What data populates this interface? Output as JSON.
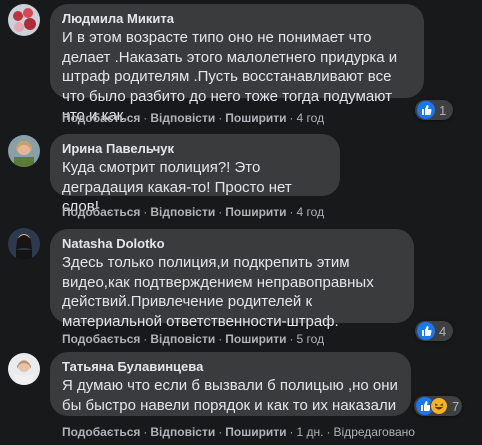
{
  "actions": {
    "like": "Подобається",
    "reply": "Відповісти",
    "share": "Поширити"
  },
  "comments": [
    {
      "author": "Людмила Микита",
      "text": "И в этом возрасте типо оно не понимает что делает .Наказать этого малолетнего придурка и штраф родителям .Пусть восстанавливают все что было разбито до него тоже тогда подумают что и как.",
      "time": "4 год",
      "reactions": {
        "types": [
          "like-icon"
        ],
        "count": "1"
      }
    },
    {
      "author": "Ирина Павельчук",
      "text": "Куда смотрит полиция?! Это деградация какая-то! Просто нет слов!",
      "time": "4 год"
    },
    {
      "author": "Natasha Dolotko",
      "text": "Здесь только полиция,и подкрепить этим видео,как подтверждением неправоправных действий.Привлечение родителей к материальной ответственности-штраф.",
      "time": "5 год",
      "reactions": {
        "types": [
          "like-icon"
        ],
        "count": "4"
      }
    },
    {
      "author": "Татьяна Булавинцева",
      "text": "Я думаю что если б вызвали б полицыю ,но они бы быстро навели порядок и как то их наказали .",
      "time": "1 дн.",
      "edited": "Відредаговано",
      "reactions": {
        "types": [
          "like-icon",
          "haha-icon"
        ],
        "count": "7"
      }
    }
  ]
}
